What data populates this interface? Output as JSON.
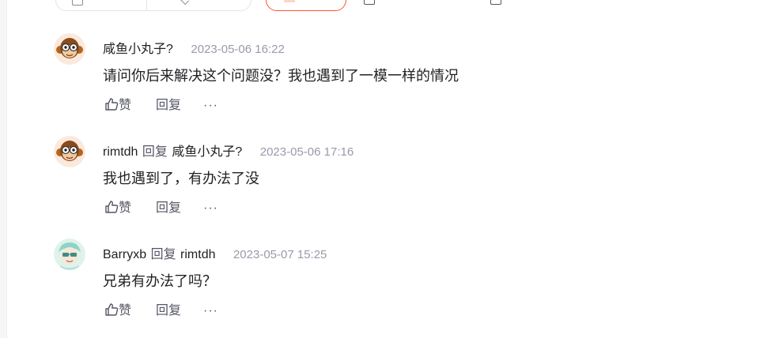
{
  "comments": [
    {
      "user": "咸鱼小丸子?",
      "reply_word": "",
      "reply_to": "",
      "time": "2023-05-06 16:22",
      "text": "请问你后来解决这个问题没？我也遇到了一模一样的情况",
      "avatar_icon": "monkey-avatar-icon"
    },
    {
      "user": "rimtdh",
      "reply_word": "回复",
      "reply_to": "咸鱼小丸子?",
      "time": "2023-05-06 17:16",
      "text": "我也遇到了，有办法了没",
      "avatar_icon": "monkey-avatar-icon"
    },
    {
      "user": "Barryxb",
      "reply_word": "回复",
      "reply_to": "rimtdh",
      "time": "2023-05-07 15:25",
      "text": "兄弟有办法了吗？",
      "avatar_icon": "cartoon-avatar-icon"
    }
  ],
  "actions": {
    "like": "赞",
    "reply": "回复",
    "more": "···"
  },
  "colors": {
    "accent": "#fc5531",
    "text": "#222226",
    "secondary": "#555666",
    "muted": "#999aaa"
  }
}
